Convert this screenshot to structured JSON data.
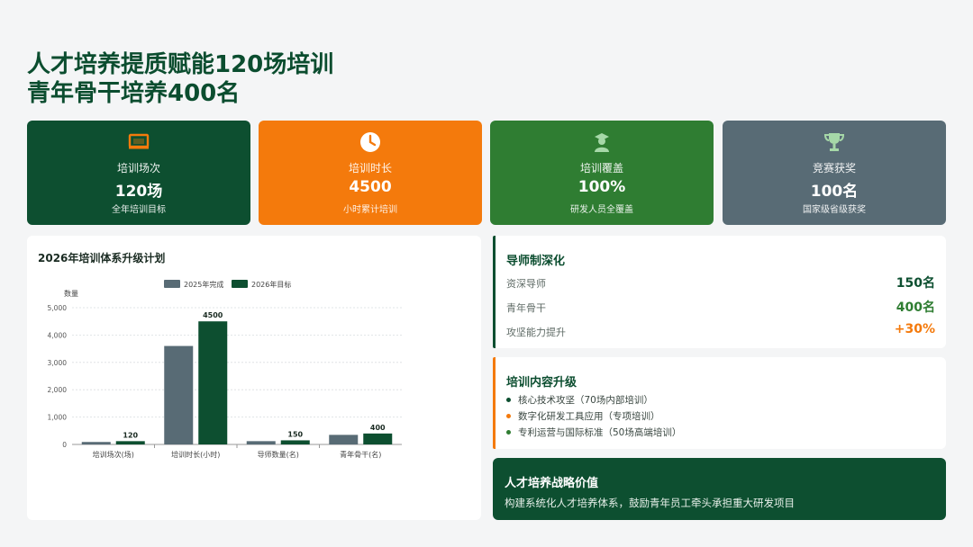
{
  "header": {
    "title_line1": "人才培养提质赋能120场培训",
    "title_line2": "青年骨干培养400名"
  },
  "kpis": [
    {
      "icon": "chalkboard-icon",
      "label": "培训场次",
      "value": "120场",
      "sub": "全年培训目标",
      "color": "#0d4f30"
    },
    {
      "icon": "clock-icon",
      "label": "培训时长",
      "value": "4500",
      "sub": "小时累计培训",
      "color": "#f47a0c"
    },
    {
      "icon": "graduate-icon",
      "label": "培训覆盖",
      "value": "100%",
      "sub": "研发人员全覆盖",
      "color": "#2f7d32"
    },
    {
      "icon": "trophy-icon",
      "label": "竞赛获奖",
      "value": "100名",
      "sub": "国家级省级获奖",
      "color": "#586b75"
    }
  ],
  "chart_data": {
    "type": "bar",
    "title": "2026年培训体系升级计划",
    "ylabel": "数量",
    "ylim": [
      0,
      5000
    ],
    "yticks": [
      0,
      1000,
      2000,
      3000,
      4000,
      5000
    ],
    "ytick_labels": [
      "0",
      "1,000",
      "2,000",
      "3,000",
      "4,000",
      "5,000"
    ],
    "grid": true,
    "legend_position": "top-center",
    "categories": [
      "培训场次(场)",
      "培训时长(小时)",
      "导师数量(名)",
      "青年骨干(名)"
    ],
    "series": [
      {
        "name": "2025年完成",
        "values": [
          90,
          3600,
          120,
          350
        ],
        "color": "#586b75"
      },
      {
        "name": "2026年目标",
        "values": [
          120,
          4500,
          150,
          400
        ],
        "color": "#0d4f30",
        "labels": [
          "120",
          "4500",
          "150",
          "400"
        ]
      }
    ]
  },
  "mentor": {
    "title": "导师制深化",
    "rows": [
      {
        "label": "资深导师",
        "value": "150名",
        "color": "#0d4f30"
      },
      {
        "label": "青年骨干",
        "value": "400名",
        "color": "#2f7d32"
      },
      {
        "label": "攻坚能力提升",
        "value": "+30%",
        "color": "#f47a0c"
      }
    ]
  },
  "content": {
    "title": "培训内容升级",
    "items": [
      {
        "text": "核心技术攻坚（70场内部培训）",
        "dot": "#0d4f30"
      },
      {
        "text": "数字化研发工具应用（专项培训）",
        "dot": "#f47a0c"
      },
      {
        "text": "专利运营与国际标准（50场高端培训）",
        "dot": "#2f7d32"
      }
    ]
  },
  "strategy": {
    "title": "人才培养战略价值",
    "text": "构建系统化人才培养体系，鼓励青年员工牵头承担重大研发项目"
  },
  "colors": {
    "accent_green": "#0d4f30",
    "accent_orange": "#f47a0c",
    "mid_green": "#2f7d32",
    "slate": "#586b75"
  }
}
